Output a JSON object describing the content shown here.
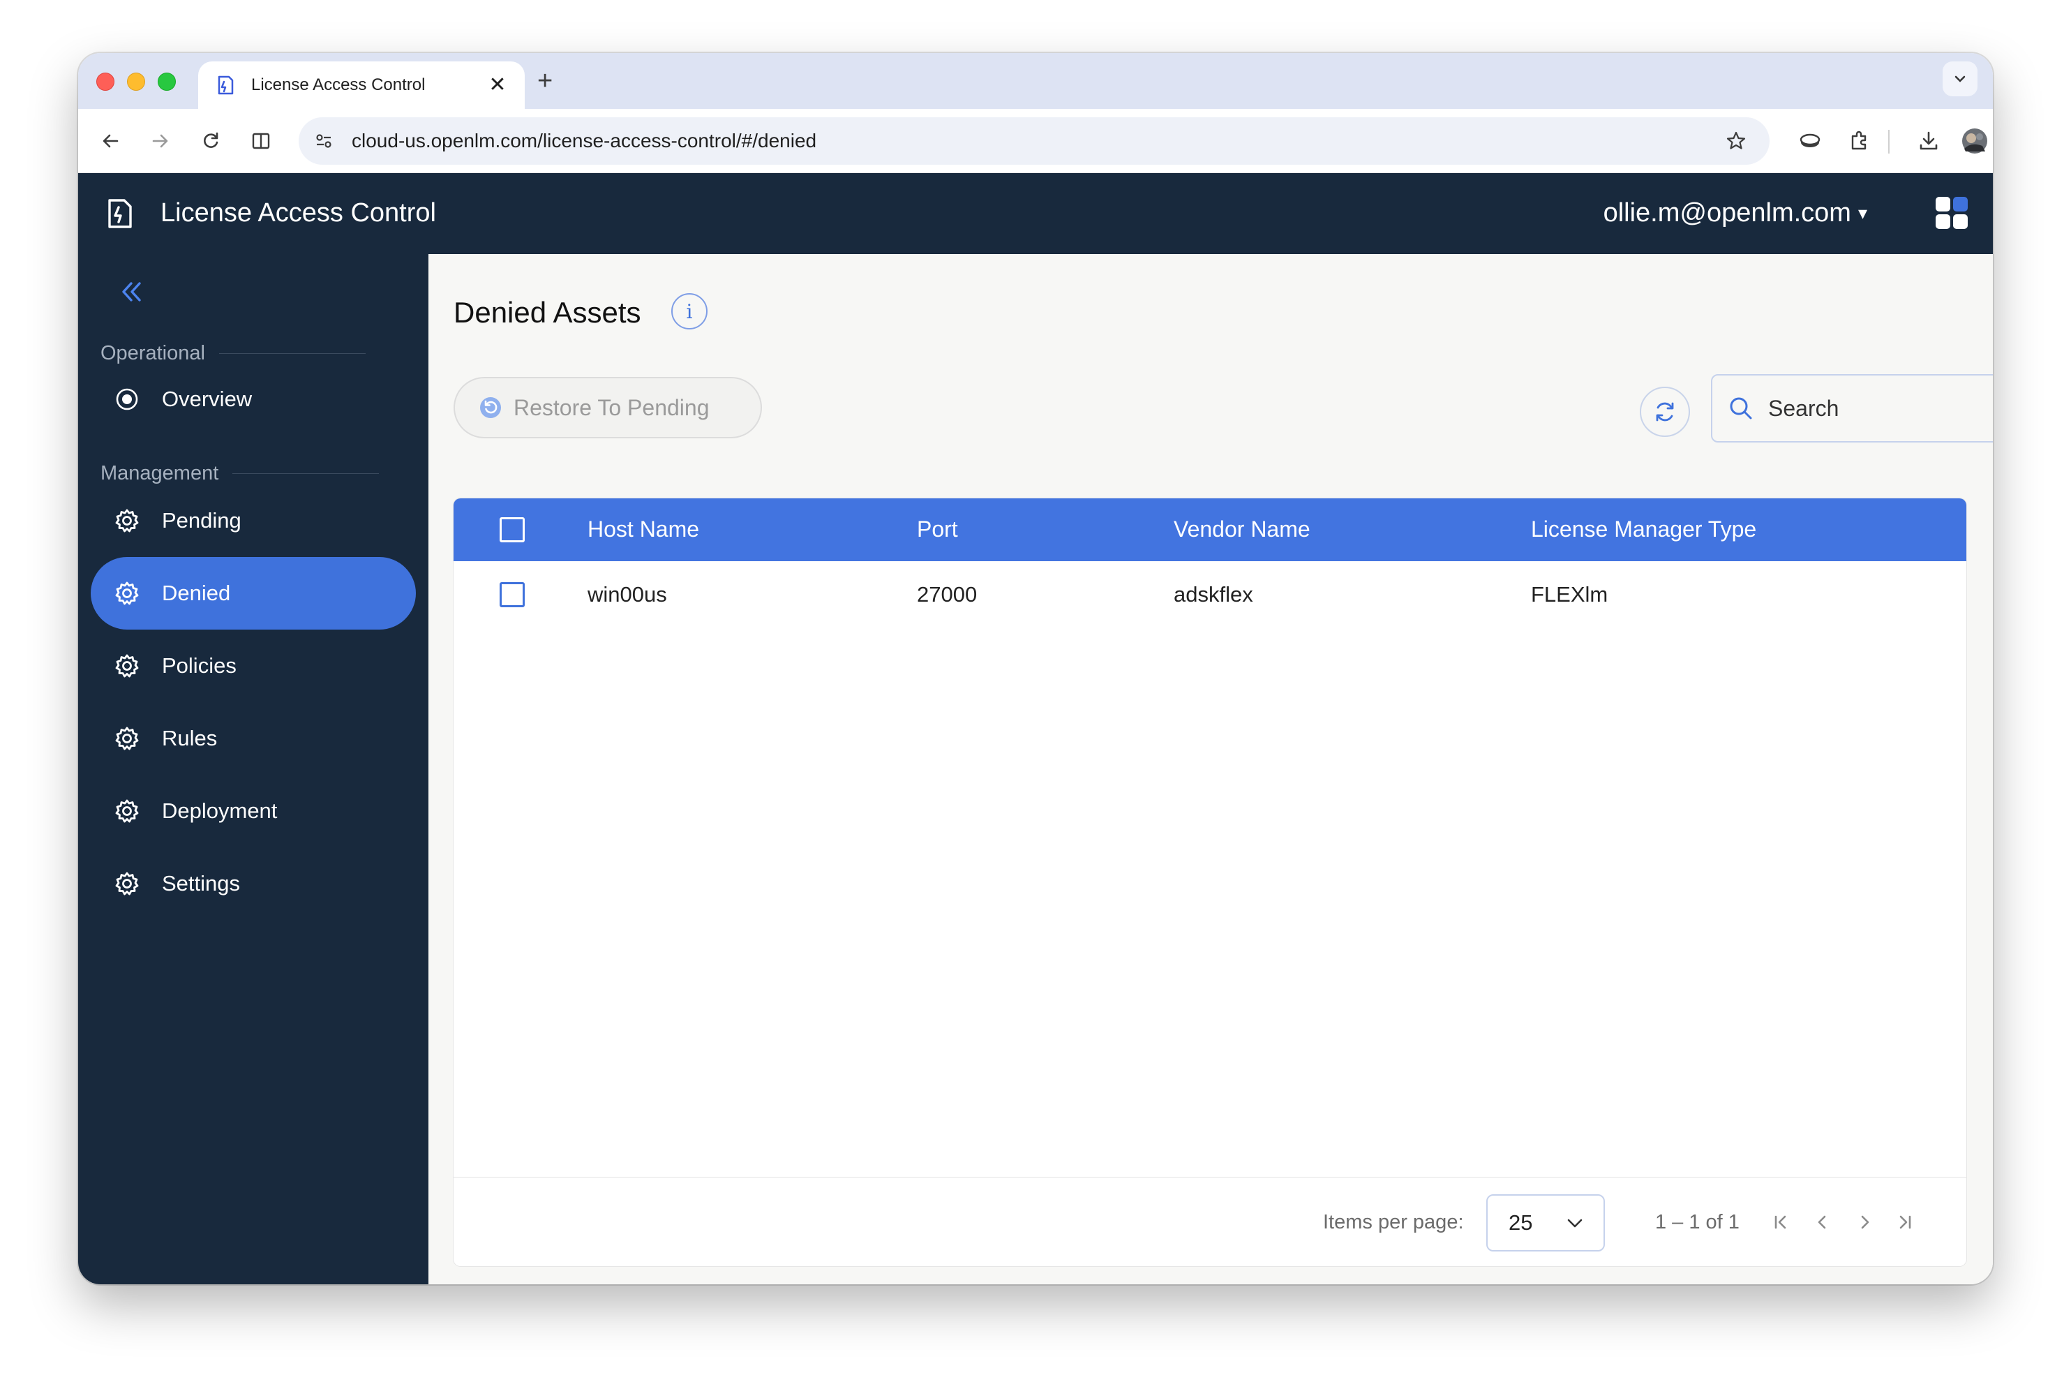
{
  "browser": {
    "tab_title": "License Access Control",
    "tab_close": "✕",
    "new_tab": "+",
    "url": "cloud-us.openlm.com/license-access-control/#/denied"
  },
  "app": {
    "title": "License Access Control",
    "user": "ollie.m@openlm.com",
    "user_caret": "▾"
  },
  "sidebar": {
    "sections": [
      {
        "label": "Operational"
      },
      {
        "label": "Management"
      }
    ],
    "items": [
      {
        "label": "Overview",
        "icon": "radio-dot-icon",
        "active": false
      },
      {
        "label": "Pending",
        "icon": "gear-icon",
        "active": false
      },
      {
        "label": "Denied",
        "icon": "gear-icon",
        "active": true
      },
      {
        "label": "Policies",
        "icon": "gear-icon",
        "active": false
      },
      {
        "label": "Rules",
        "icon": "gear-icon",
        "active": false
      },
      {
        "label": "Deployment",
        "icon": "gear-icon",
        "active": false
      },
      {
        "label": "Settings",
        "icon": "gear-icon",
        "active": false
      }
    ]
  },
  "page": {
    "title": "Denied Assets",
    "info": "i",
    "restore_label": "Restore To Pending",
    "search_placeholder": "Search"
  },
  "table": {
    "columns": [
      "Host Name",
      "Port",
      "Vendor Name",
      "License Manager Type"
    ],
    "rows": [
      {
        "host": "win00us",
        "port": "27000",
        "vendor": "adskflex",
        "lmt": "FLEXlm"
      }
    ]
  },
  "pagination": {
    "items_per_page_label": "Items per page:",
    "items_per_page_value": "25",
    "range": "1 – 1 of 1"
  },
  "colors": {
    "header_bg": "#18293d",
    "accent": "#3f72dc",
    "table_header": "#4274e0"
  }
}
